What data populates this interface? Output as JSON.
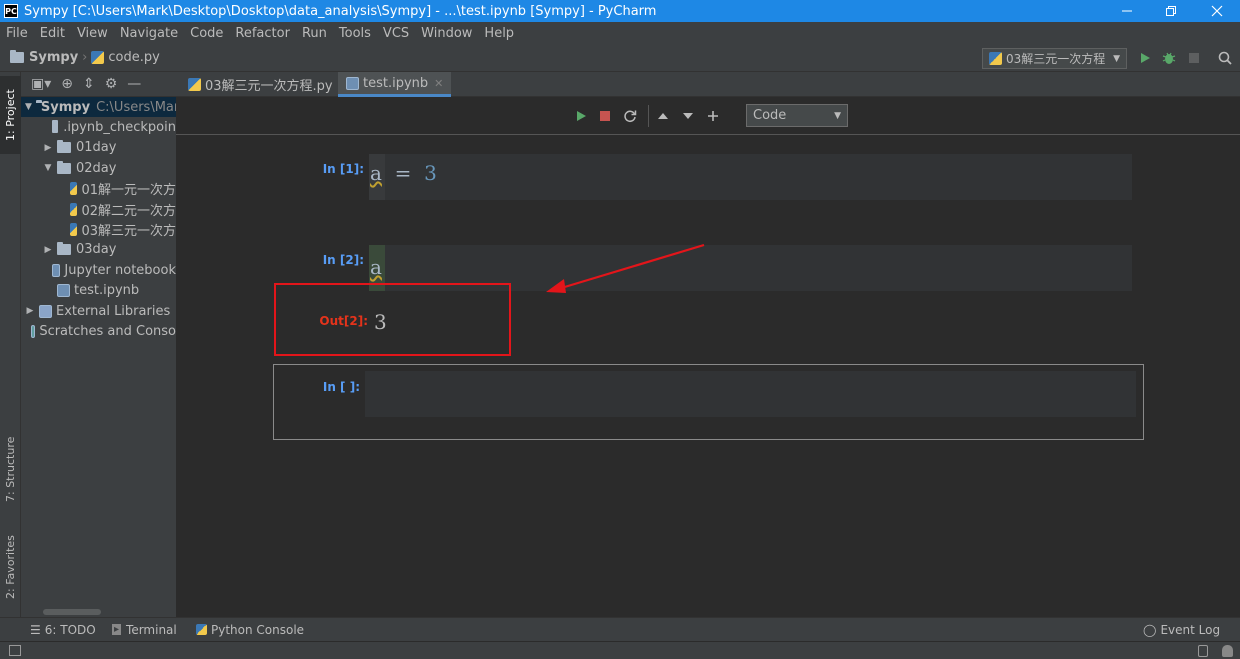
{
  "window": {
    "title": "Sympy [C:\\Users\\Mark\\Desktop\\Dosktop\\data_analysis\\Sympy] - ...\\test.ipynb [Sympy] - PyCharm",
    "app_icon_label": "PC"
  },
  "menu": [
    "File",
    "Edit",
    "View",
    "Navigate",
    "Code",
    "Refactor",
    "Run",
    "Tools",
    "VCS",
    "Window",
    "Help"
  ],
  "breadcrumb": {
    "project": "Sympy",
    "file": "code.py"
  },
  "run_config": {
    "label": "03解三元一次方程"
  },
  "side_tabs": {
    "project": "1: Project",
    "structure": "7: Structure",
    "favorites": "2: Favorites"
  },
  "project_tree": [
    {
      "label": "Sympy",
      "extra": "C:\\Users\\Mar",
      "level": 0,
      "arrow": "down",
      "icon": "folder-icon"
    },
    {
      "label": ".ipynb_checkpoin",
      "level": 1,
      "arrow": "",
      "icon": "folder-icon"
    },
    {
      "label": "01day",
      "level": 1,
      "arrow": "right",
      "icon": "folder-icon"
    },
    {
      "label": "02day",
      "level": 1,
      "arrow": "down",
      "icon": "folder-icon"
    },
    {
      "label": "01解一元一次方",
      "level": 2,
      "arrow": "",
      "icon": "python-file-icon"
    },
    {
      "label": "02解二元一次方",
      "level": 2,
      "arrow": "",
      "icon": "python-file-icon"
    },
    {
      "label": "03解三元一次方",
      "level": 2,
      "arrow": "",
      "icon": "python-file-icon"
    },
    {
      "label": "03day",
      "level": 1,
      "arrow": "right",
      "icon": "folder-icon"
    },
    {
      "label": "Jupyter notebook",
      "level": 1,
      "arrow": "",
      "icon": "notebook-file-icon"
    },
    {
      "label": "test.ipynb",
      "level": 1,
      "arrow": "",
      "icon": "notebook-file-icon"
    },
    {
      "label": "External Libraries",
      "level": 0,
      "arrow": "right",
      "icon": "library-icon"
    },
    {
      "label": "Scratches and Conso",
      "level": 0,
      "arrow": "",
      "icon": "scratches-icon"
    }
  ],
  "editor_tabs": [
    {
      "label": "03解三元一次方程.py",
      "active": false
    },
    {
      "label": "test.ipynb",
      "active": true
    }
  ],
  "notebook": {
    "cell_type": "Code",
    "cells": [
      {
        "prompt": "In [1]:",
        "code_var": "a",
        "code_op": "=",
        "code_num": "3"
      },
      {
        "prompt": "In [2]:",
        "code_var": "a",
        "output_prompt": "Out[2]:",
        "output": "3"
      },
      {
        "prompt": "In [ ]:"
      }
    ]
  },
  "bottom_tools": {
    "todo": "6: TODO",
    "terminal": "Terminal",
    "python_console": "Python Console",
    "event_log": "Event Log"
  },
  "colors": {
    "accent_blue": "#1e88e5",
    "highlight_red": "#e3151a",
    "prompt_blue": "#589df6",
    "out_red": "#e5331b"
  }
}
